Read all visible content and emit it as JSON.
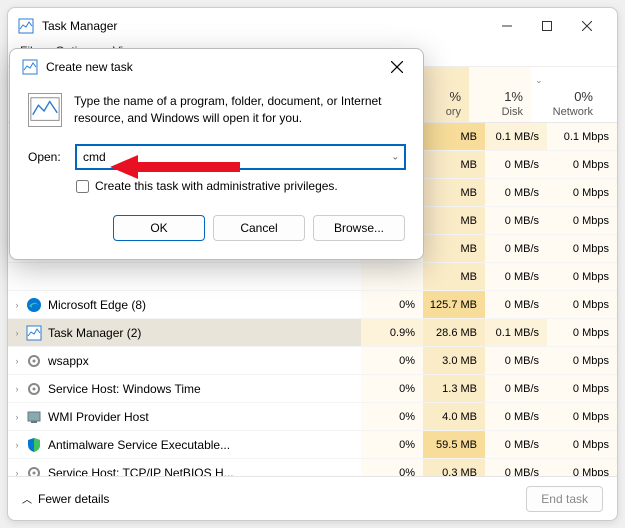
{
  "window": {
    "title": "Task Manager",
    "menus": [
      "File",
      "Options",
      "View"
    ]
  },
  "columns": {
    "memory_pct": "%",
    "memory_label": "ory",
    "disk_pct": "1%",
    "disk_label": "Disk",
    "network_pct": "0%",
    "network_label": "Network"
  },
  "rows": [
    {
      "name": "",
      "cpu": "",
      "mem": "MB",
      "disk": "0.1 MB/s",
      "net": "0.1 Mbps",
      "mem_hi": true,
      "disk_act": true,
      "hidden": true
    },
    {
      "name": "",
      "cpu": "",
      "mem": "MB",
      "disk": "0 MB/s",
      "net": "0 Mbps",
      "hidden": true
    },
    {
      "name": "",
      "cpu": "",
      "mem": "MB",
      "disk": "0 MB/s",
      "net": "0 Mbps",
      "hidden": true
    },
    {
      "name": "",
      "cpu": "",
      "mem": "MB",
      "disk": "0 MB/s",
      "net": "0 Mbps",
      "hidden": true
    },
    {
      "name": "",
      "cpu": "",
      "mem": "MB",
      "disk": "0 MB/s",
      "net": "0 Mbps",
      "hidden": true
    },
    {
      "name": "",
      "cpu": "",
      "mem": "MB",
      "disk": "0 MB/s",
      "net": "0 Mbps",
      "hidden": true
    },
    {
      "name": "Microsoft Edge (8)",
      "cpu": "0%",
      "mem": "125.7 MB",
      "disk": "0 MB/s",
      "net": "0 Mbps",
      "mem_hi": true,
      "icon": "edge"
    },
    {
      "name": "Task Manager (2)",
      "cpu": "0.9%",
      "mem": "28.6 MB",
      "disk": "0.1 MB/s",
      "net": "0 Mbps",
      "cpu_act": true,
      "disk_act": true,
      "sel": true,
      "icon": "tm"
    },
    {
      "name": "wsappx",
      "cpu": "0%",
      "mem": "3.0 MB",
      "disk": "0 MB/s",
      "net": "0 Mbps",
      "icon": "gear"
    },
    {
      "name": "Service Host: Windows Time",
      "cpu": "0%",
      "mem": "1.3 MB",
      "disk": "0 MB/s",
      "net": "0 Mbps",
      "icon": "gear"
    },
    {
      "name": "WMI Provider Host",
      "cpu": "0%",
      "mem": "4.0 MB",
      "disk": "0 MB/s",
      "net": "0 Mbps",
      "icon": "wmi"
    },
    {
      "name": "Antimalware Service Executable...",
      "cpu": "0%",
      "mem": "59.5 MB",
      "disk": "0 MB/s",
      "net": "0 Mbps",
      "mem_hi": true,
      "icon": "shield"
    },
    {
      "name": "Service Host: TCP/IP NetBIOS H...",
      "cpu": "0%",
      "mem": "0.3 MB",
      "disk": "0 MB/s",
      "net": "0 Mbps",
      "icon": "gear"
    }
  ],
  "bottom": {
    "fewer": "Fewer details",
    "endtask": "End task"
  },
  "dialog": {
    "title": "Create new task",
    "desc": "Type the name of a program, folder, document, or Internet resource, and Windows will open it for you.",
    "open_label": "Open:",
    "open_value": "cmd",
    "admin_label": "Create this task with administrative privileges.",
    "ok": "OK",
    "cancel": "Cancel",
    "browse": "Browse..."
  }
}
